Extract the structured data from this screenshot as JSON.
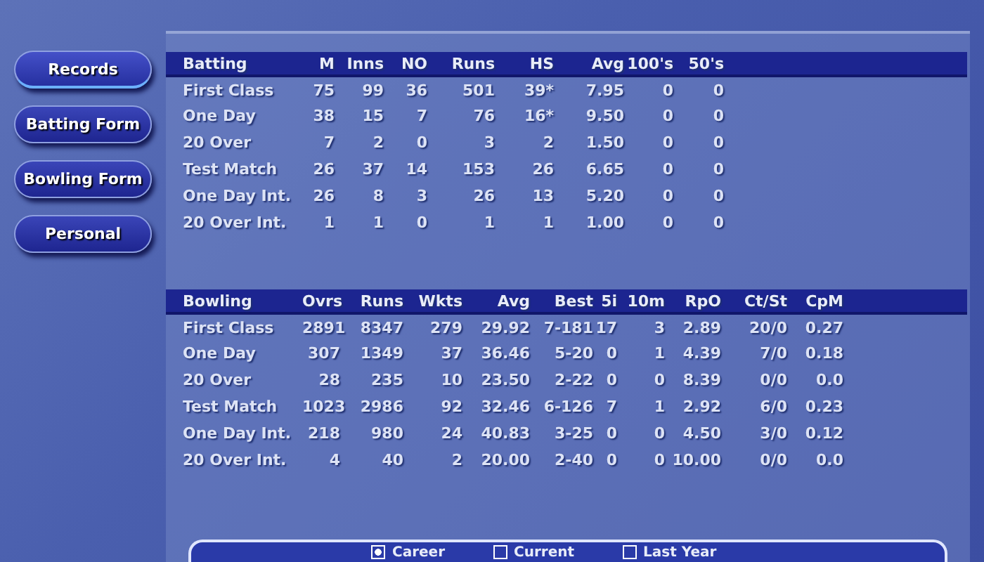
{
  "nav": [
    {
      "label": "Records",
      "selected": true
    },
    {
      "label": "Batting Form",
      "selected": false
    },
    {
      "label": "Bowling Form",
      "selected": false
    },
    {
      "label": "Personal",
      "selected": false
    }
  ],
  "batting": {
    "columns": [
      "Batting",
      "M",
      "Inns",
      "NO",
      "Runs",
      "HS",
      "Avg",
      "100's",
      "50's"
    ],
    "rows": [
      [
        "First Class",
        "75",
        "99",
        "36",
        "501",
        "39*",
        "7.95",
        "0",
        "0"
      ],
      [
        "One Day",
        "38",
        "15",
        "7",
        "76",
        "16*",
        "9.50",
        "0",
        "0"
      ],
      [
        "20 Over",
        "7",
        "2",
        "0",
        "3",
        "2",
        "1.50",
        "0",
        "0"
      ],
      [
        "Test Match",
        "26",
        "37",
        "14",
        "153",
        "26",
        "6.65",
        "0",
        "0"
      ],
      [
        "One Day Int.",
        "26",
        "8",
        "3",
        "26",
        "13",
        "5.20",
        "0",
        "0"
      ],
      [
        "20 Over Int.",
        "1",
        "1",
        "0",
        "1",
        "1",
        "1.00",
        "0",
        "0"
      ]
    ]
  },
  "bowling": {
    "columns": [
      "Bowling",
      "Ovrs",
      "Runs",
      "Wkts",
      "Avg",
      "Best",
      "5i",
      "10m",
      "RpO",
      "Ct/St",
      "CpM"
    ],
    "rows": [
      [
        "First Class",
        "2891",
        "8347",
        "279",
        "29.92",
        "7-181",
        "17",
        "3",
        "2.89",
        "20/0",
        "0.27"
      ],
      [
        "One Day",
        "307",
        "1349",
        "37",
        "36.46",
        "5-20",
        "0",
        "1",
        "4.39",
        "7/0",
        "0.18"
      ],
      [
        "20 Over",
        "28",
        "235",
        "10",
        "23.50",
        "2-22",
        "0",
        "0",
        "8.39",
        "0/0",
        "0.0"
      ],
      [
        "Test Match",
        "1023",
        "2986",
        "92",
        "32.46",
        "6-126",
        "7",
        "1",
        "2.92",
        "6/0",
        "0.23"
      ],
      [
        "One Day Int.",
        "218",
        "980",
        "24",
        "40.83",
        "3-25",
        "0",
        "0",
        "4.50",
        "3/0",
        "0.12"
      ],
      [
        "20 Over Int.",
        "4",
        "40",
        "2",
        "20.00",
        "2-40",
        "0",
        "0",
        "10.00",
        "0/0",
        "0.0"
      ]
    ]
  },
  "period_options": [
    {
      "label": "Career",
      "selected": true
    },
    {
      "label": "Current",
      "selected": false
    },
    {
      "label": "Last Year",
      "selected": false
    }
  ]
}
